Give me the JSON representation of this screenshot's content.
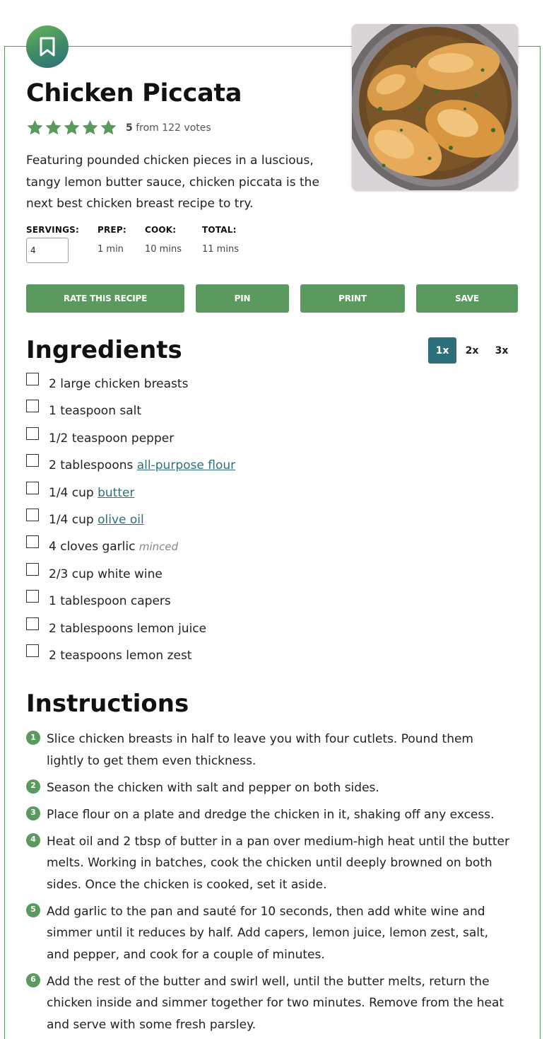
{
  "recipe": {
    "title": "Chicken Piccata",
    "rating": {
      "value": "5",
      "suffix": "from 122 votes",
      "stars": 5
    },
    "summary": "Featuring pounded chicken pieces in a luscious, tangy lemon butter sauce, chicken piccata is the next best chicken breast recipe to try.",
    "image_alt": "Chicken Piccata"
  },
  "meta": {
    "servings_label": "SERVINGS:",
    "servings_value": "4",
    "prep_label": "PREP:",
    "prep_value": "1 min",
    "cook_label": "COOK:",
    "cook_value": "10 mins",
    "total_label": "TOTAL:",
    "total_value": "11 mins"
  },
  "actions": {
    "rate": "RATE THIS RECIPE",
    "pin": "PIN",
    "print": "PRINT",
    "save": "SAVE"
  },
  "ingredients": {
    "heading": "Ingredients",
    "scale": [
      "1x",
      "2x",
      "3x"
    ],
    "items": [
      {
        "amount": "2 large chicken breasts",
        "link": "",
        "note": ""
      },
      {
        "amount": "1 teaspoon salt",
        "link": "",
        "note": ""
      },
      {
        "amount": "1/2 teaspoon pepper",
        "link": "",
        "note": ""
      },
      {
        "amount": "2 tablespoons ",
        "link": "all-purpose flour",
        "note": ""
      },
      {
        "amount": "1/4 cup ",
        "link": "butter",
        "note": ""
      },
      {
        "amount": "1/4 cup ",
        "link": "olive oil",
        "note": ""
      },
      {
        "amount": "4 cloves garlic ",
        "link": "",
        "note": "minced"
      },
      {
        "amount": "2/3 cup white wine",
        "link": "",
        "note": ""
      },
      {
        "amount": "1 tablespoon capers",
        "link": "",
        "note": ""
      },
      {
        "amount": "2 tablespoons lemon juice",
        "link": "",
        "note": ""
      },
      {
        "amount": "2 teaspoons lemon zest",
        "link": "",
        "note": ""
      }
    ]
  },
  "instructions": {
    "heading": "Instructions",
    "steps": [
      {
        "num": "1",
        "text": "Slice chicken breasts in half to leave you with four cutlets. Pound them lightly to get them even thickness."
      },
      {
        "num": "2",
        "text": "Season the chicken with salt and pepper on both sides."
      },
      {
        "num": "3",
        "text": "Place flour on a plate and dredge the chicken in it, shaking off any excess."
      },
      {
        "num": "4",
        "text": "Heat oil and 2 tbsp of butter in a pan over medium-high heat until the butter melts. Working in batches, cook the chicken until deeply browned on both sides. Once the chicken is cooked, set it aside."
      },
      {
        "num": "5",
        "text": "Add garlic to the pan and sauté for 10 seconds, then add white wine and simmer until it reduces by half. Add capers, lemon juice, lemon zest, salt, and pepper, and cook for a couple of minutes."
      },
      {
        "num": "6",
        "text": "Add the rest of the butter and swirl well, until the butter melts, return the chicken inside and simmer together for two minutes. Remove from the heat and serve with some fresh parsley."
      }
    ]
  },
  "colors": {
    "brand_green": "#5a9a5e",
    "accent_teal": "#2e6f7c",
    "star": "#5a9a5e"
  },
  "icons": {
    "bookmark": "bookmark-icon",
    "star": "star-icon",
    "step_number": "step-number-badge"
  }
}
